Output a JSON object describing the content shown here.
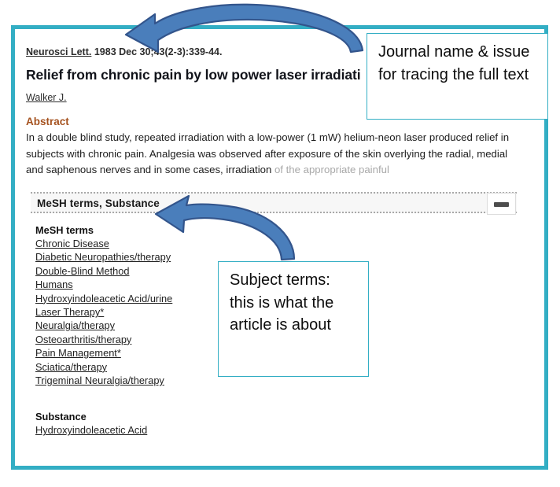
{
  "record": {
    "journal_name": "Neurosci Lett.",
    "journal_issue": "1983 Dec 30;43(2-3):339-44.",
    "title": "Relief from chronic pain by low power laser irradiati",
    "authors": "Walker J.",
    "abstract_heading": "Abstract",
    "abstract_text": "In a double blind study, repeated irradiation with a low-power (1 mW) helium-neon laser produced relief in subjects with chronic pain. Analgesia was observed after exposure of the skin overlying the radial, medial and saphenous nerves and in some cases, irradiation ",
    "abstract_faded_text": "of the appropriate painful"
  },
  "mesh_panel": {
    "header_label": "MeSH terms, Substance",
    "collapse_icon": "minus-icon",
    "mesh_terms_label": "MeSH terms",
    "mesh_terms": [
      "Chronic Disease",
      "Diabetic Neuropathies/therapy",
      "Double-Blind Method",
      "Humans",
      "Hydroxyindoleacetic Acid/urine",
      "Laser Therapy*",
      "Neuralgia/therapy",
      "Osteoarthritis/therapy",
      "Pain Management*",
      "Sciatica/therapy",
      "Trigeminal Neuralgia/therapy"
    ],
    "substance_label": "Substance",
    "substances": [
      "Hydroxyindoleacetic Acid"
    ]
  },
  "annotations": {
    "journal_callout": "Journal name & issue for tracing the full text",
    "subject_callout": "Subject terms: this is what the article is about",
    "arrow_icon": "curved-arrow-icon"
  },
  "colors": {
    "frame_teal": "#33aec4",
    "arrow_blue": "#4a7ebb",
    "arrow_outline": "#33558c",
    "abstract_heading": "#a5521f",
    "faded_text": "#a8a8a8"
  }
}
